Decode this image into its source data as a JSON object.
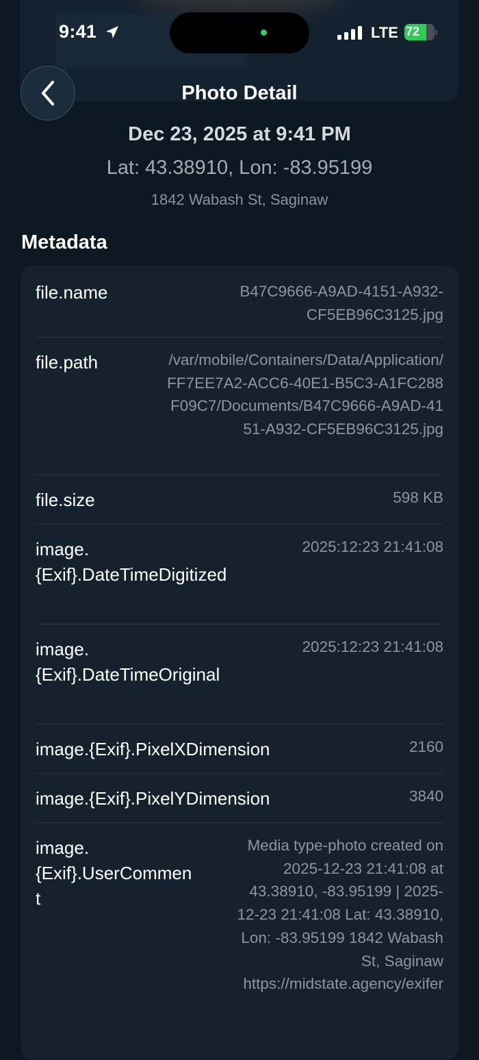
{
  "status_bar": {
    "time": "9:41",
    "network": "LTE",
    "battery": "72",
    "battery_level": 0.72,
    "colors": {
      "battery_fill": "#34c759",
      "island_indicator": "#2fd158"
    }
  },
  "nav": {
    "back_icon": "chevron-left-icon",
    "title": "Photo Detail"
  },
  "header": {
    "datetime": "Dec 23, 2025 at 9:41 PM",
    "coordinates": "Lat: 43.38910, Lon: -83.95199",
    "address": "1842 Wabash St, Saginaw"
  },
  "metadata": {
    "title": "Metadata",
    "rows": [
      {
        "key": "file.name",
        "value": "B47C9666-A9AD-4151-A932-CF5EB96C3125.jpg"
      },
      {
        "key": "file.path",
        "value": "/var/mobile/Containers/Data/Application/FF7EE7A2-ACC6-40E1-B5C3-A1FC288F09C7/Documents/B47C9666-A9AD-4151-A932-CF5EB96C3125.jpg"
      },
      {
        "key": "file.size",
        "value": "598 KB"
      },
      {
        "key": "image.{Exif}.DateTimeDigitized",
        "value": "2025:12:23 21:41:08"
      },
      {
        "key": "image.{Exif}.DateTimeOriginal",
        "value": "2025:12:23 21:41:08"
      },
      {
        "key": "image.{Exif}.PixelXDimension",
        "value": "2160"
      },
      {
        "key": "image.{Exif}.PixelYDimension",
        "value": "3840"
      },
      {
        "key": "image.{Exif}.UserComment",
        "value": "Media type-photo created on 2025-12-23 21:41:08 at 43.38910, -83.95199 | 2025-12-23 21:41:08 Lat: 43.38910, Lon: -83.95199 1842 Wabash St, Saginaw https://midstate.agency/exifer"
      }
    ]
  }
}
